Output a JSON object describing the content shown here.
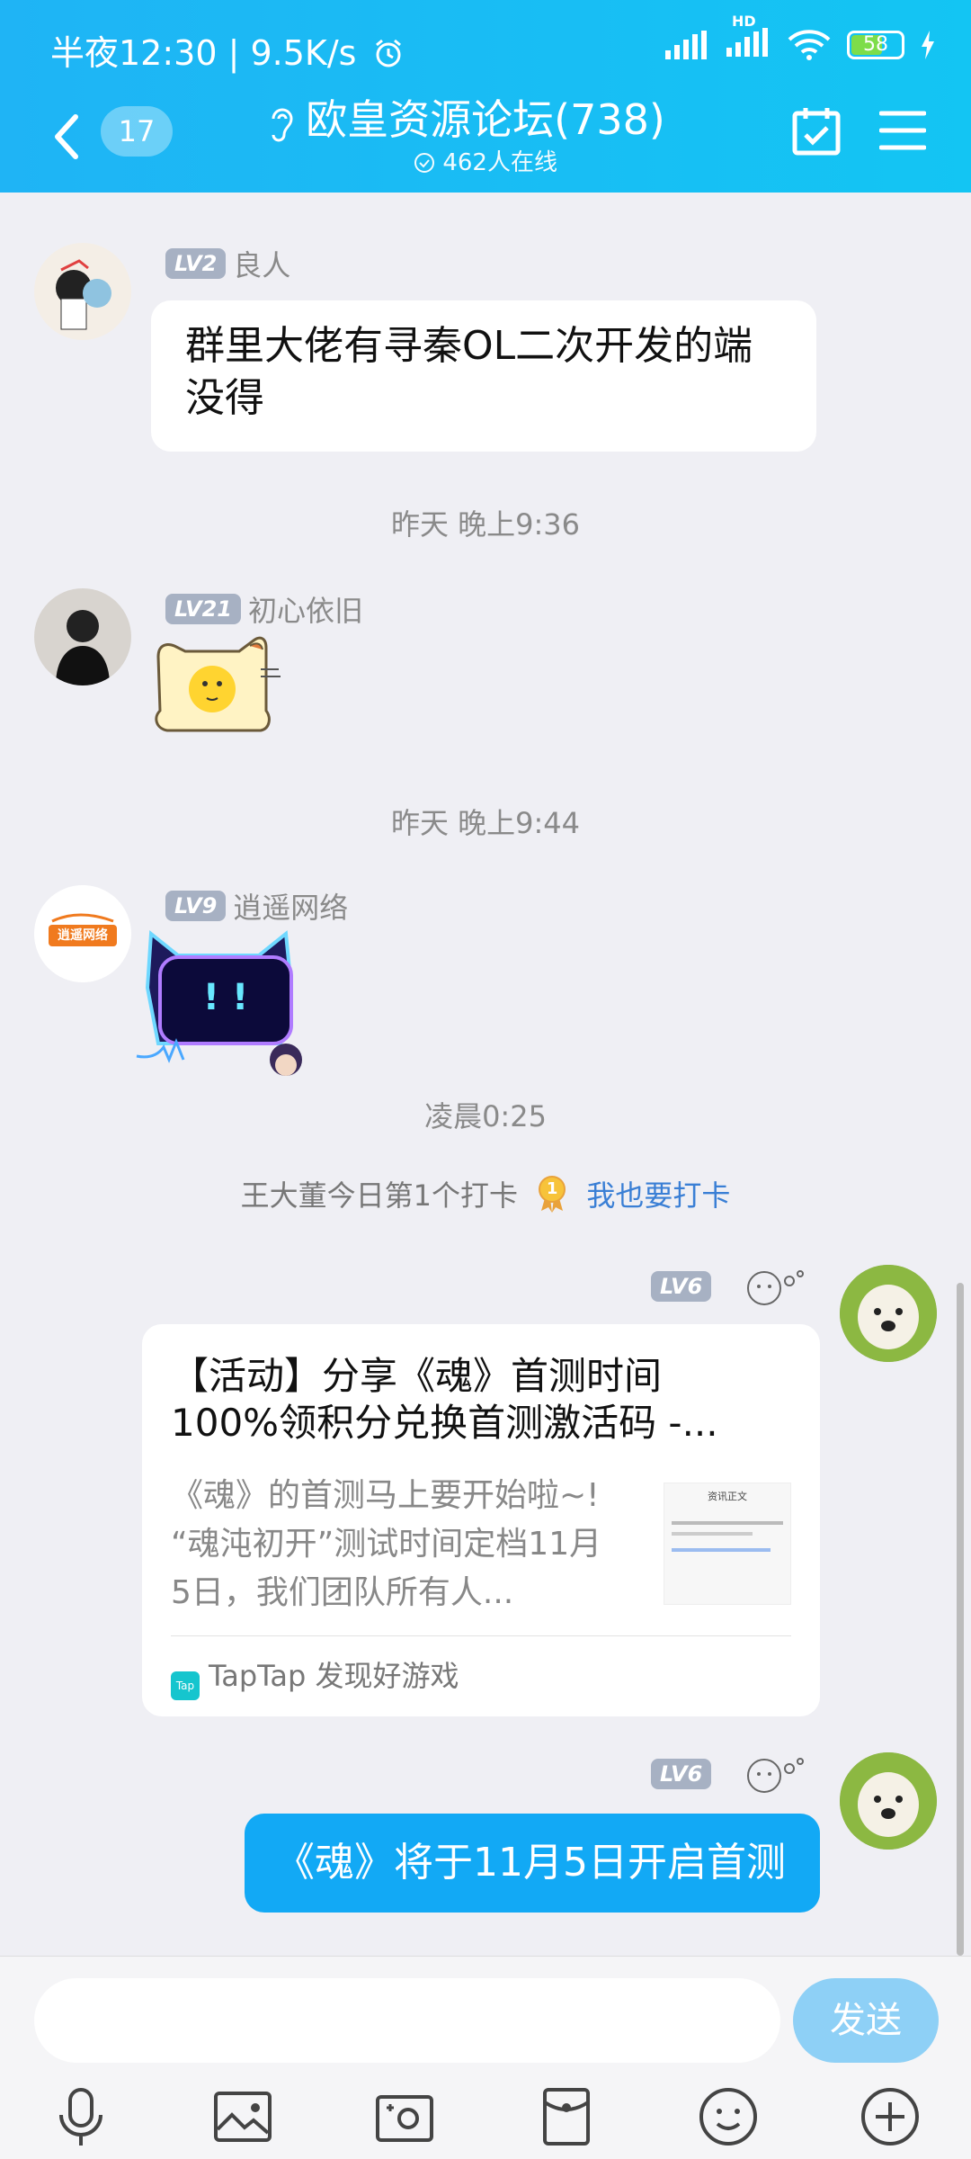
{
  "status_bar": {
    "time": "半夜12:30",
    "speed": "9.5K/s",
    "battery": "58",
    "signal_hd": "HD"
  },
  "header": {
    "unread_count": "17",
    "title": "欧皇资源论坛(738)",
    "online": "462人在线"
  },
  "messages": {
    "m1": {
      "level": "LV2",
      "name": "良人",
      "text_line1": "群里大佬有寻秦OL二次开发的端",
      "text_line2": "没得"
    },
    "time1": "昨天 晚上9:36",
    "m2": {
      "level": "LV21",
      "name": "初心依旧"
    },
    "time2": "昨天 晚上9:44",
    "m3": {
      "level": "LV9",
      "name": "逍遥网络",
      "avatar_text": "逍遥网络",
      "sticker_text": "! !"
    },
    "time3": "凌晨0:25",
    "checkin": {
      "text": "王大董今日第1个打卡",
      "medal": "1",
      "link": "我也要打卡"
    },
    "m4": {
      "level": "LV6",
      "card_title_line1": "【活动】分享《魂》首测时间",
      "card_title_line2": "100%领积分兑换首测激活码 -...",
      "card_desc_line1": "《魂》的首测马上要开始啦~!",
      "card_desc_line2": "“魂沌初开”测试时间定档11月",
      "card_desc_line3": "5日，我们团队所有人...",
      "thumb_title": "资讯正文",
      "source_icon": "Tap",
      "source": "TapTap 发现好游戏"
    },
    "m5": {
      "level": "LV6",
      "text": "《魂》将于11月5日开启首测"
    }
  },
  "input_bar": {
    "send_label": "发送"
  },
  "colors": {
    "accent": "#12a9f5",
    "header": "#1fb4f5",
    "send_disabled": "#8ed0f6",
    "link": "#3a7fd5"
  }
}
